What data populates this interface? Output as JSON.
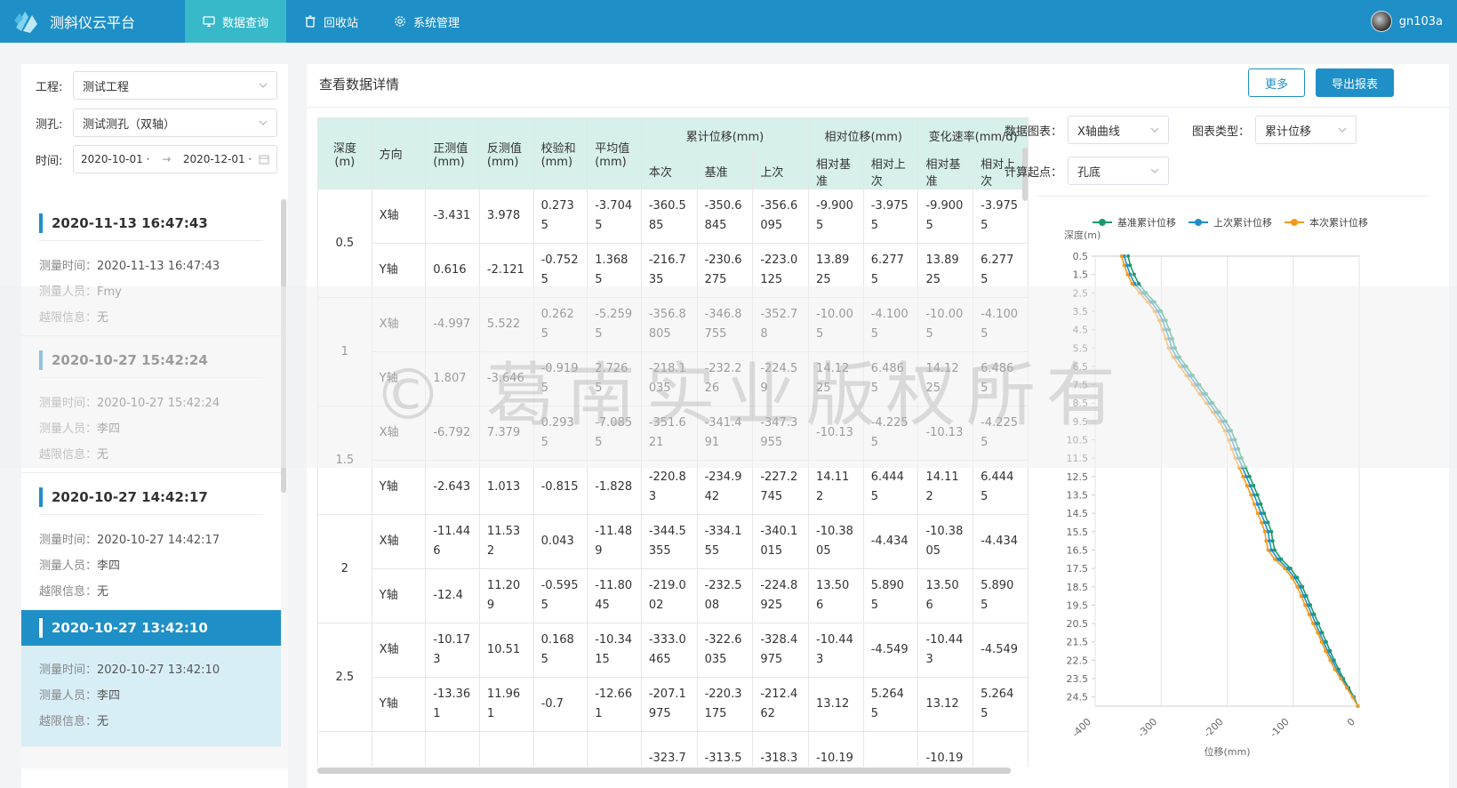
{
  "app": {
    "title": "测斜仪云平台",
    "nav": [
      {
        "label": "数据查询",
        "icon": "monitor-icon",
        "active": true
      },
      {
        "label": "回收站",
        "icon": "trash-icon",
        "active": false
      },
      {
        "label": "系统管理",
        "icon": "gear-icon",
        "active": false
      }
    ],
    "user": "gn103a"
  },
  "filters": {
    "project_label": "工程:",
    "project_value": "测试工程",
    "hole_label": "测孔:",
    "hole_value": "测试测孔（双轴）",
    "time_label": "时间:",
    "time_start": "2020-10-01 ·",
    "time_end": "2020-12-01 ·"
  },
  "records": [
    {
      "title": "2020-11-13 16:47:43",
      "time_key": "测量时间：",
      "time": "2020-11-13 16:47:43",
      "person_key": "测量人员：",
      "person": "Fmy",
      "limit_key": "越限信息：",
      "limit": "无"
    },
    {
      "title": "2020-10-27 15:42:24",
      "time_key": "测量时间：",
      "time": "2020-10-27 15:42:24",
      "person_key": "测量人员：",
      "person": "李四",
      "limit_key": "越限信息：",
      "limit": "无"
    },
    {
      "title": "2020-10-27 14:42:17",
      "time_key": "测量时间：",
      "time": "2020-10-27 14:42:17",
      "person_key": "测量人员：",
      "person": "李四",
      "limit_key": "越限信息：",
      "limit": "无"
    },
    {
      "title": "2020-10-27 13:42:10",
      "time_key": "测量时间：",
      "time": "2020-10-27 13:42:10",
      "person_key": "测量人员：",
      "person": "李四",
      "limit_key": "越限信息：",
      "limit": "无",
      "active": true
    }
  ],
  "main": {
    "title": "查看数据详情",
    "more_button": "更多",
    "export_button": "导出报表"
  },
  "table": {
    "headers": {
      "depth": "深度(m)",
      "direction": "方向",
      "forward": "正测值(mm)",
      "reverse": "反测值(mm)",
      "checksum": "校验和(mm)",
      "average": "平均值(mm)",
      "cum_group": "累计位移(mm)",
      "cum_current": "本次",
      "cum_base": "基准",
      "cum_last": "上次",
      "rel_group": "相对位移(mm)",
      "rel_base": "相对基准",
      "rel_last": "相对上次",
      "rate_group": "变化速率(mm/d)",
      "rate_base": "相对基准",
      "rate_last": "相对上次"
    },
    "rows": [
      {
        "depth": "0.5",
        "dir": "X轴",
        "cells": [
          "-3.431",
          "3.978",
          "0.2735",
          "-3.7045",
          "-360.585",
          "-350.6845",
          "-356.6095",
          "-9.9005",
          "-3.9755",
          "-9.9005",
          "-3.9755"
        ]
      },
      {
        "depth": "",
        "dir": "Y轴",
        "cells": [
          "0.616",
          "-2.121",
          "-0.7525",
          "1.3685",
          "-216.735",
          "-230.6275",
          "-223.0125",
          "13.8925",
          "6.2775",
          "13.8925",
          "6.2775"
        ]
      },
      {
        "depth": "1",
        "dir": "X轴",
        "cells": [
          "-4.997",
          "5.522",
          "0.2625",
          "-5.2595",
          "-356.8805",
          "-346.8755",
          "-352.78",
          "-10.005",
          "-4.1005",
          "-10.005",
          "-4.1005"
        ]
      },
      {
        "depth": "",
        "dir": "Y轴",
        "cells": [
          "1.807",
          "-3.646",
          "-0.9195",
          "2.7265",
          "-218.1035",
          "-232.226",
          "-224.59",
          "14.1225",
          "6.4865",
          "14.1225",
          "6.4865"
        ]
      },
      {
        "depth": "1.5",
        "dir": "X轴",
        "cells": [
          "-6.792",
          "7.379",
          "0.2935",
          "-7.0855",
          "-351.621",
          "-341.491",
          "-347.3955",
          "-10.13",
          "-4.2255",
          "-10.13",
          "-4.2255"
        ]
      },
      {
        "depth": "",
        "dir": "Y轴",
        "cells": [
          "-2.643",
          "1.013",
          "-0.815",
          "-1.828",
          "-220.83",
          "-234.942",
          "-227.2745",
          "14.112",
          "6.4445",
          "14.112",
          "6.4445"
        ]
      },
      {
        "depth": "2",
        "dir": "X轴",
        "cells": [
          "-11.446",
          "11.532",
          "0.043",
          "-11.489",
          "-344.5355",
          "-334.155",
          "-340.1015",
          "-10.3805",
          "-4.434",
          "-10.3805",
          "-4.434"
        ]
      },
      {
        "depth": "",
        "dir": "Y轴",
        "cells": [
          "-12.4",
          "11.209",
          "-0.5955",
          "-11.8045",
          "-219.002",
          "-232.508",
          "-224.8925",
          "13.506",
          "5.8905",
          "13.506",
          "5.8905"
        ]
      },
      {
        "depth": "2.5",
        "dir": "X轴",
        "cells": [
          "-10.173",
          "10.51",
          "0.1685",
          "-10.3415",
          "-333.0465",
          "-322.6035",
          "-328.4975",
          "-10.443",
          "-4.549",
          "-10.443",
          "-4.549"
        ]
      },
      {
        "depth": "",
        "dir": "Y轴",
        "cells": [
          "-13.361",
          "11.961",
          "-0.7",
          "-12.661",
          "-207.1975",
          "-220.3175",
          "-212.462",
          "13.12",
          "5.2645",
          "13.12",
          "5.2645"
        ]
      },
      {
        "depth": "",
        "dir": "",
        "cells": [
          "",
          "",
          "",
          "",
          "-323.7",
          "-313.5",
          "-318.3",
          "-10.19",
          "",
          "-10.19",
          ""
        ]
      }
    ]
  },
  "chart_controls": {
    "data_chart_label": "数据图表：",
    "data_chart_value": "X轴曲线",
    "chart_type_label": "图表类型：",
    "chart_type_value": "累计位移",
    "calc_start_label": "计算起点：",
    "calc_start_value": "孔底"
  },
  "watermark": "© 葛南实业版权所有",
  "chart_data": {
    "type": "line",
    "xlabel": "位移(mm)",
    "ylabel": "深度(m)",
    "xlim": [
      -400,
      0
    ],
    "ylim": [
      0.5,
      24.5
    ],
    "x_ticks": [
      "-400",
      "-300",
      "-200",
      "-100",
      "0"
    ],
    "y_ticks": [
      "0.5",
      "1.5",
      "2.5",
      "3.5",
      "4.5",
      "5.5",
      "6.5",
      "7.5",
      "8.5",
      "9.5",
      "10.5",
      "11.5",
      "12.5",
      "13.5",
      "14.5",
      "15.5",
      "16.5",
      "17.5",
      "18.5",
      "19.5",
      "20.5",
      "21.5",
      "22.5",
      "23.5",
      "24.5"
    ],
    "legend_position": "top",
    "series": [
      {
        "name": "基准累计位移",
        "color": "#1a9a6c",
        "points": [
          [
            -350,
            0.5
          ],
          [
            -347,
            1.0
          ],
          [
            -341,
            1.5
          ],
          [
            -334,
            2.0
          ],
          [
            -323,
            2.5
          ],
          [
            -310,
            3.0
          ],
          [
            -300,
            3.5
          ],
          [
            -293,
            4.0
          ],
          [
            -288,
            4.5
          ],
          [
            -283,
            5.0
          ],
          [
            -279,
            5.5
          ],
          [
            -272,
            6.0
          ],
          [
            -262,
            6.5
          ],
          [
            -252,
            7.0
          ],
          [
            -242,
            7.5
          ],
          [
            -232,
            8.0
          ],
          [
            -222,
            8.5
          ],
          [
            -212,
            9.0
          ],
          [
            -202,
            9.5
          ],
          [
            -194,
            10.0
          ],
          [
            -188,
            10.5
          ],
          [
            -183,
            11.0
          ],
          [
            -178,
            11.5
          ],
          [
            -172,
            12.0
          ],
          [
            -166,
            12.5
          ],
          [
            -160,
            13.0
          ],
          [
            -154,
            13.5
          ],
          [
            -149,
            14.0
          ],
          [
            -144,
            14.5
          ],
          [
            -138,
            15.0
          ],
          [
            -133,
            15.5
          ],
          [
            -131,
            16.0
          ],
          [
            -128,
            16.5
          ],
          [
            -118,
            17.0
          ],
          [
            -104,
            17.5
          ],
          [
            -94,
            18.0
          ],
          [
            -86,
            18.5
          ],
          [
            -80,
            19.0
          ],
          [
            -74,
            19.5
          ],
          [
            -68,
            20.0
          ],
          [
            -62,
            20.5
          ],
          [
            -56,
            21.0
          ],
          [
            -50,
            21.5
          ],
          [
            -44,
            22.0
          ],
          [
            -38,
            22.5
          ],
          [
            -31,
            23.0
          ],
          [
            -24,
            23.5
          ],
          [
            -16,
            24.0
          ],
          [
            -8,
            24.5
          ],
          [
            -2,
            25.0
          ]
        ]
      },
      {
        "name": "上次累计位移",
        "color": "#1f8fc7",
        "points": [
          [
            -356,
            0.5
          ],
          [
            -352,
            1.0
          ],
          [
            -347,
            1.5
          ],
          [
            -340,
            2.0
          ],
          [
            -328,
            2.5
          ],
          [
            -315,
            3.0
          ],
          [
            -305,
            3.5
          ],
          [
            -298,
            4.0
          ],
          [
            -293,
            4.5
          ],
          [
            -288,
            5.0
          ],
          [
            -284,
            5.5
          ],
          [
            -277,
            6.0
          ],
          [
            -267,
            6.5
          ],
          [
            -257,
            7.0
          ],
          [
            -247,
            7.5
          ],
          [
            -237,
            8.0
          ],
          [
            -227,
            8.5
          ],
          [
            -217,
            9.0
          ],
          [
            -207,
            9.5
          ],
          [
            -199,
            10.0
          ],
          [
            -193,
            10.5
          ],
          [
            -188,
            11.0
          ],
          [
            -183,
            11.5
          ],
          [
            -177,
            12.0
          ],
          [
            -171,
            12.5
          ],
          [
            -165,
            13.0
          ],
          [
            -159,
            13.5
          ],
          [
            -154,
            14.0
          ],
          [
            -149,
            14.5
          ],
          [
            -143,
            15.0
          ],
          [
            -138,
            15.5
          ],
          [
            -136,
            16.0
          ],
          [
            -133,
            16.5
          ],
          [
            -123,
            17.0
          ],
          [
            -109,
            17.5
          ],
          [
            -98,
            18.0
          ],
          [
            -90,
            18.5
          ],
          [
            -84,
            19.0
          ],
          [
            -78,
            19.5
          ],
          [
            -72,
            20.0
          ],
          [
            -66,
            20.5
          ],
          [
            -60,
            21.0
          ],
          [
            -54,
            21.5
          ],
          [
            -48,
            22.0
          ],
          [
            -41,
            22.5
          ],
          [
            -34,
            23.0
          ],
          [
            -26,
            23.5
          ],
          [
            -18,
            24.0
          ],
          [
            -9,
            24.5
          ],
          [
            -2,
            25.0
          ]
        ]
      },
      {
        "name": "本次累计位移",
        "color": "#f39a1a",
        "points": [
          [
            -360,
            0.5
          ],
          [
            -356,
            1.0
          ],
          [
            -351,
            1.5
          ],
          [
            -344,
            2.0
          ],
          [
            -333,
            2.5
          ],
          [
            -320,
            3.0
          ],
          [
            -310,
            3.5
          ],
          [
            -303,
            4.0
          ],
          [
            -298,
            4.5
          ],
          [
            -293,
            5.0
          ],
          [
            -289,
            5.5
          ],
          [
            -282,
            6.0
          ],
          [
            -272,
            6.5
          ],
          [
            -262,
            7.0
          ],
          [
            -252,
            7.5
          ],
          [
            -242,
            8.0
          ],
          [
            -232,
            8.5
          ],
          [
            -222,
            9.0
          ],
          [
            -212,
            9.5
          ],
          [
            -204,
            10.0
          ],
          [
            -198,
            10.5
          ],
          [
            -193,
            11.0
          ],
          [
            -188,
            11.5
          ],
          [
            -182,
            12.0
          ],
          [
            -176,
            12.5
          ],
          [
            -170,
            13.0
          ],
          [
            -164,
            13.5
          ],
          [
            -159,
            14.0
          ],
          [
            -154,
            14.5
          ],
          [
            -148,
            15.0
          ],
          [
            -143,
            15.5
          ],
          [
            -141,
            16.0
          ],
          [
            -138,
            16.5
          ],
          [
            -128,
            17.0
          ],
          [
            -113,
            17.5
          ],
          [
            -102,
            18.0
          ],
          [
            -94,
            18.5
          ],
          [
            -88,
            19.0
          ],
          [
            -82,
            19.5
          ],
          [
            -76,
            20.0
          ],
          [
            -70,
            20.5
          ],
          [
            -63,
            21.0
          ],
          [
            -57,
            21.5
          ],
          [
            -51,
            22.0
          ],
          [
            -44,
            22.5
          ],
          [
            -37,
            23.0
          ],
          [
            -28,
            23.5
          ],
          [
            -19,
            24.0
          ],
          [
            -10,
            24.5
          ],
          [
            -2,
            25.0
          ]
        ]
      }
    ]
  }
}
